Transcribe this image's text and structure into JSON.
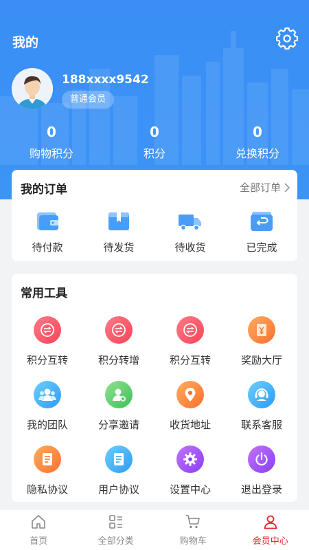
{
  "header": {
    "title": "我的",
    "phone": "188xxxx9542",
    "member_level": "普通会员"
  },
  "stats": [
    {
      "value": "0",
      "label": "购物积分"
    },
    {
      "value": "0",
      "label": "积分"
    },
    {
      "value": "0",
      "label": "兑换积分"
    }
  ],
  "orders": {
    "title": "我的订单",
    "all_label": "全部订单",
    "items": [
      {
        "label": "待付款",
        "icon": "wallet-icon"
      },
      {
        "label": "待发货",
        "icon": "box-icon"
      },
      {
        "label": "待收货",
        "icon": "truck-icon"
      },
      {
        "label": "已完成",
        "icon": "return-icon"
      }
    ]
  },
  "tools": {
    "title": "常用工具",
    "items": [
      {
        "label": "积分互转",
        "icon": "exchange-icon"
      },
      {
        "label": "积分转增",
        "icon": "exchange-icon"
      },
      {
        "label": "积分互转",
        "icon": "exchange-icon"
      },
      {
        "label": "奖励大厅",
        "icon": "yuan-icon"
      },
      {
        "label": "我的团队",
        "icon": "team-icon"
      },
      {
        "label": "分享邀请",
        "icon": "invite-icon"
      },
      {
        "label": "收货地址",
        "icon": "location-icon"
      },
      {
        "label": "联系客服",
        "icon": "headset-icon"
      },
      {
        "label": "隐私协议",
        "icon": "document-icon"
      },
      {
        "label": "用户协议",
        "icon": "document-icon"
      },
      {
        "label": "设置中心",
        "icon": "gear-icon"
      },
      {
        "label": "退出登录",
        "icon": "power-icon"
      }
    ]
  },
  "tabbar": [
    {
      "label": "首页",
      "icon": "home-icon",
      "active": false
    },
    {
      "label": "全部分类",
      "icon": "category-icon",
      "active": false
    },
    {
      "label": "购物车",
      "icon": "cart-icon",
      "active": false
    },
    {
      "label": "会员中心",
      "icon": "user-icon",
      "active": true
    }
  ],
  "colors": {
    "header_blue": "#3a8ef5",
    "active_tab": "#e8232f"
  }
}
